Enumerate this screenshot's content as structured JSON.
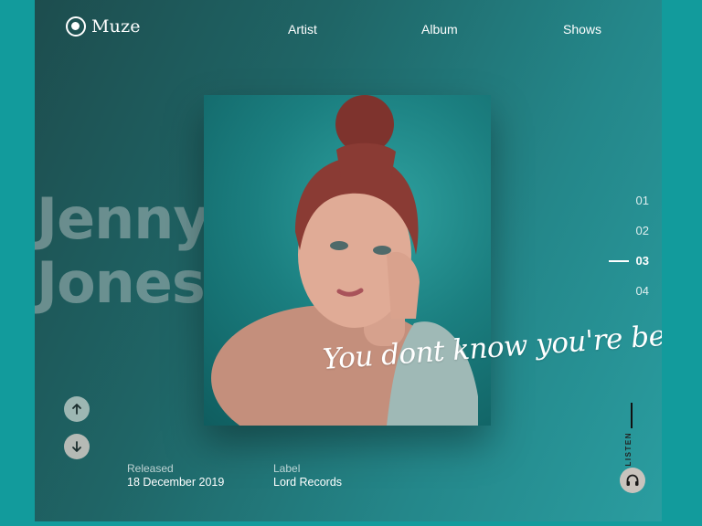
{
  "brand": {
    "name": "Muze"
  },
  "nav": {
    "items": [
      {
        "label": "Artist"
      },
      {
        "label": "Album"
      },
      {
        "label": "Shows"
      }
    ]
  },
  "artist": {
    "first_name": "Jenny",
    "last_name": "Jones"
  },
  "tagline": "You dont know you're beautiful",
  "pager": {
    "items": [
      "01",
      "02",
      "03",
      "04"
    ],
    "active": "03"
  },
  "release": {
    "released_label": "Released",
    "released_value": "18 December 2019",
    "label_label": "Label",
    "label_value": "Lord Records"
  },
  "listen": {
    "label": "LISTEN"
  },
  "icons": {
    "up": "arrow-up-icon",
    "down": "arrow-down-icon",
    "listen": "headphones-icon",
    "logo": "logo-circle-icon"
  },
  "colors": {
    "bg": "#129b9c",
    "card_dark": "#1d4d4e",
    "card_light": "#2a9da0"
  }
}
